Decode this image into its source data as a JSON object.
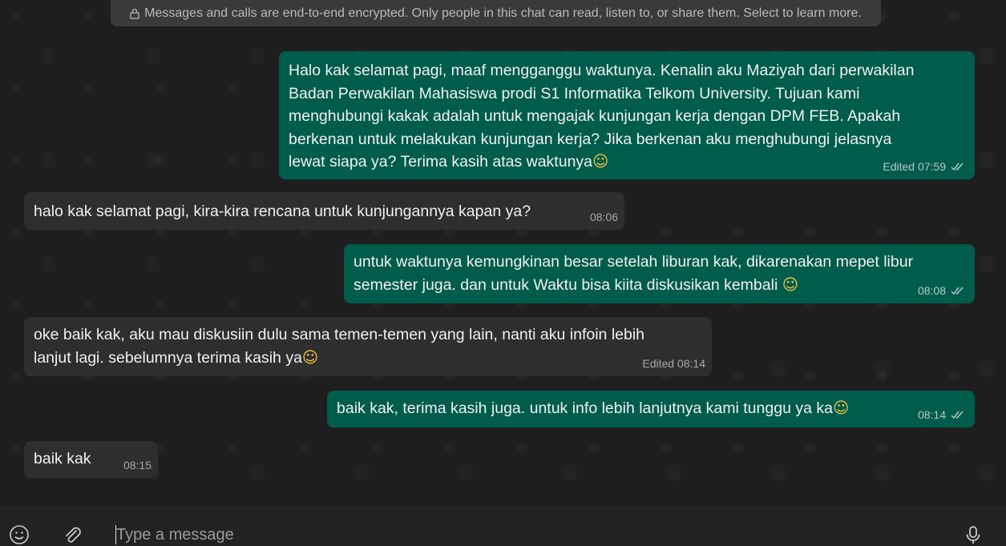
{
  "banner": {
    "text": "Messages and calls are end-to-end encrypted. Only people in this chat can read, listen to, or share them. Select to learn more."
  },
  "messages": [
    {
      "direction": "outgoing",
      "text": "Halo kak selamat pagi, maaf mengganggu waktunya. Kenalin aku Maziyah dari perwakilan\nBadan Perwakilan Mahasiswa prodi S1 Informatika Telkom University. Tujuan kami\nmenghubungi kakak adalah untuk mengajak kunjungan kerja dengan DPM FEB. Apakah\nberkenan untuk melakukan kunjungan kerja? Jika berkenan aku menghubungi jelasnya\nlewat siapa ya? Terima kasih atas waktunya",
      "emoji": "☺",
      "meta": "Edited 07:59",
      "status": "read-ticks-icon"
    },
    {
      "direction": "incoming",
      "text": "halo kak selamat pagi, kira-kira rencana untuk kunjungannya kapan ya?",
      "emoji": "",
      "meta": "08:06"
    },
    {
      "direction": "outgoing",
      "text": "untuk waktunya kemungkinan besar setelah liburan kak, dikarenakan mepet libur\nsemester juga. dan untuk Waktu bisa kiita diskusikan kembali ",
      "emoji": "☺",
      "meta": "08:08",
      "status": "read-ticks-icon"
    },
    {
      "direction": "incoming",
      "text": "oke baik kak, aku mau diskusiin dulu sama temen-temen yang lain, nanti aku infoin lebih\nlanjut lagi. sebelumnya terima kasih ya",
      "emoji": "☺",
      "meta": "Edited 08:14"
    },
    {
      "direction": "outgoing",
      "text": "baik kak, terima kasih juga. untuk info lebih lanjutnya kami tunggu ya ka",
      "emoji": "☺",
      "meta": "08:14",
      "status": "read-ticks-icon"
    },
    {
      "direction": "incoming",
      "text": "baik kak",
      "emoji": "",
      "meta": "08:15"
    }
  ],
  "composer": {
    "placeholder": "Type a message",
    "value": "",
    "icons": [
      "emoji-icon",
      "attach-icon",
      "microphone-icon"
    ]
  },
  "colors": {
    "outgoing_bubble": "#005c4b",
    "incoming_bubble": "#2e2e2e",
    "background": "#1e1e1e"
  }
}
